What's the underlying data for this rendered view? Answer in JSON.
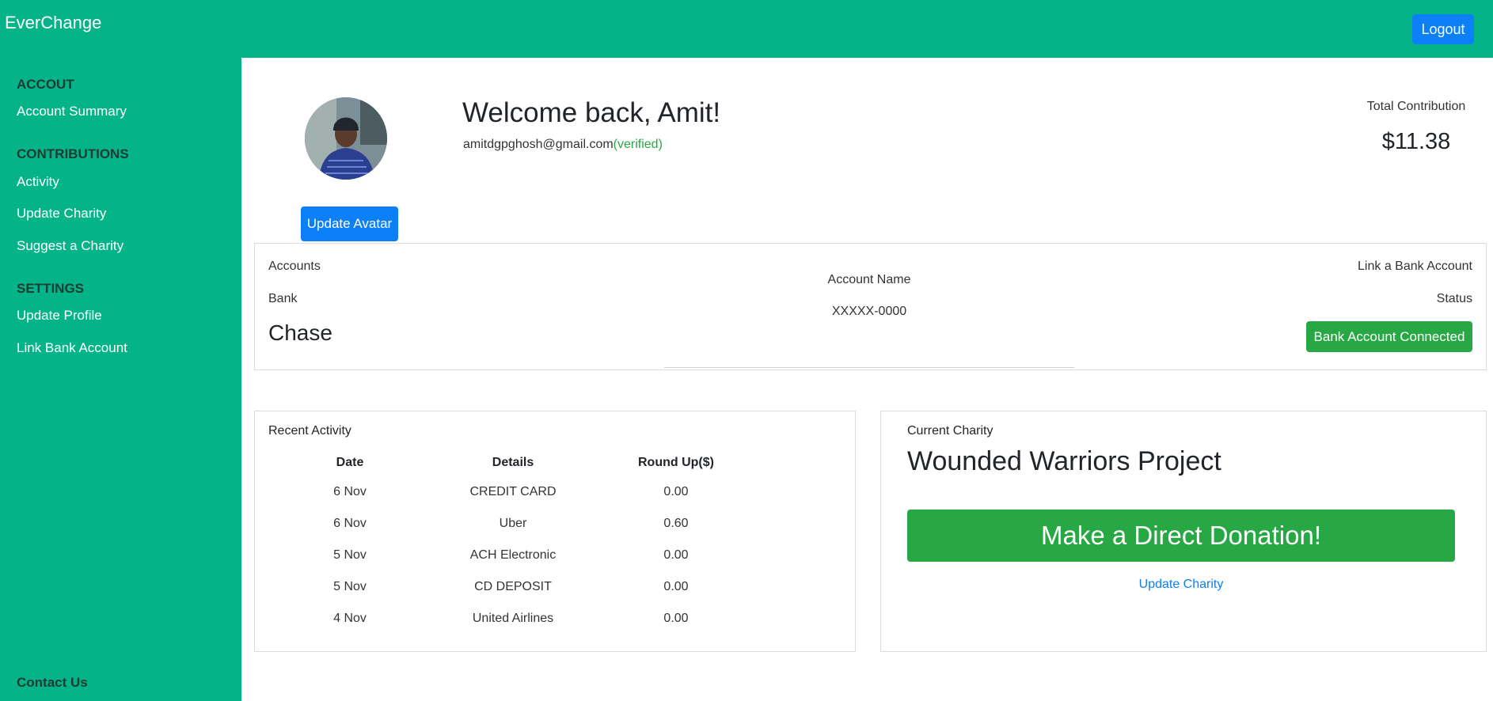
{
  "header": {
    "brand": "EverChange",
    "logout_label": "Logout"
  },
  "sidebar": {
    "sections": [
      {
        "heading": "ACCOUT",
        "items": [
          "Account Summary"
        ]
      },
      {
        "heading": "CONTRIBUTIONS",
        "items": [
          "Activity",
          "Update Charity",
          "Suggest a Charity"
        ]
      },
      {
        "heading": "SETTINGS",
        "items": [
          "Update Profile",
          "Link Bank Account"
        ]
      }
    ],
    "contact": "Contact Us"
  },
  "profile": {
    "welcome": "Welcome back, Amit!",
    "email": "amitdgpghosh@gmail.com",
    "verified": "(verified)",
    "update_avatar_label": "Update Avatar",
    "total_label": "Total Contribution",
    "total_amount": "$11.38"
  },
  "accounts": {
    "title": "Accounts",
    "bank_label": "Bank",
    "bank_name": "Chase",
    "account_name_label": "Account Name",
    "account_number": "XXXXX-0000",
    "link_label": "Link a Bank Account",
    "status_label": "Status",
    "status_button": "Bank Account Connected"
  },
  "activity": {
    "title": "Recent Activity",
    "columns": [
      "Date",
      "Details",
      "Round Up($)"
    ],
    "rows": [
      [
        "6 Nov",
        "CREDIT CARD",
        "0.00"
      ],
      [
        "6 Nov",
        "Uber",
        "0.60"
      ],
      [
        "5 Nov",
        "ACH Electronic",
        "0.00"
      ],
      [
        "5 Nov",
        "CD DEPOSIT",
        "0.00"
      ],
      [
        "4 Nov",
        "United Airlines",
        "0.00"
      ]
    ]
  },
  "charity": {
    "label": "Current Charity",
    "name": "Wounded Warriors Project",
    "donate_label": "Make a Direct Donation!",
    "update_label": "Update Charity"
  },
  "colors": {
    "brand_green": "#04b488",
    "primary_blue": "#0d7ff7",
    "success_green": "#28a745"
  }
}
